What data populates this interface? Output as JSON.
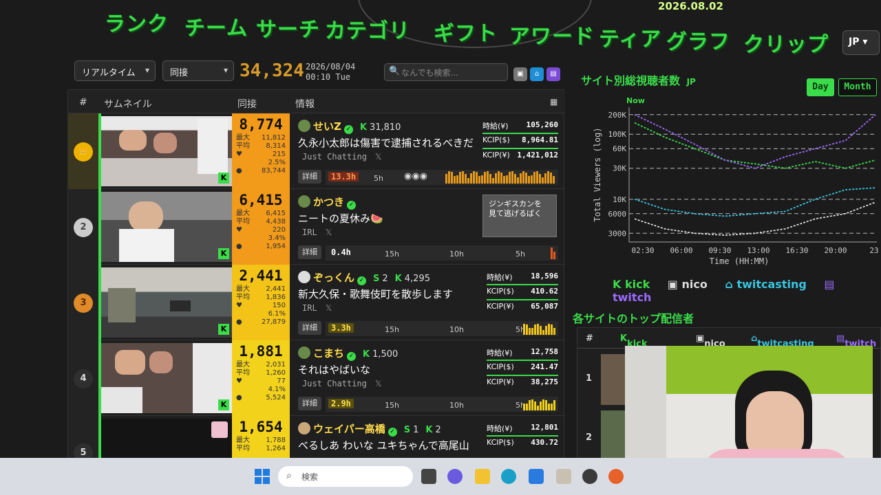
{
  "nav": {
    "items": [
      "ランク",
      "チーム",
      "サーチ",
      "カテゴリ",
      "ギフト",
      "アワード",
      "ティア",
      "グラフ",
      "クリップ"
    ],
    "date": "2026.08.02",
    "lang": "JP ▾"
  },
  "controls": {
    "mode": "リアルタイム",
    "sort": "同接",
    "total_viewers": "34,324",
    "date": "2026/08/04",
    "time": "00:10 Tue",
    "search_placeholder": "なんでも検索...",
    "sites": [
      "nico-icon",
      "twitcasting-icon",
      "twitch-icon"
    ]
  },
  "table": {
    "headers": {
      "rank": "#",
      "thumb": "サムネイル",
      "viewers": "同接",
      "info": "情報"
    },
    "rows": [
      {
        "rank": "1",
        "viewers": "8,774",
        "max_label": "最大",
        "max": "11,812",
        "avg_label": "平均",
        "avg": "8,314",
        "extra1": "215",
        "extra2": "2.5%",
        "extra3": "83,744",
        "name": "せいZ",
        "follow": "31,810",
        "title": "久永小太郎は傷害で逮捕されるべきだ",
        "category": "Just Chatting",
        "detail": "詳細",
        "duration": "13.3h",
        "tick1": "5h",
        "stat1_label": "時給(¥)",
        "stat1": "105,260",
        "stat2_label": "KCIP($)",
        "stat2": "8,964.81",
        "stat3_label": "KCIP(¥)",
        "stat3": "1,421,012"
      },
      {
        "rank": "2",
        "viewers": "6,415",
        "max_label": "最大",
        "max": "6,415",
        "avg_label": "平均",
        "avg": "4,438",
        "extra1": "220",
        "extra2": "3.4%",
        "extra3": "1,954",
        "name": "かつき",
        "title": "ニートの夏休み🍉",
        "category": "IRL",
        "detail": "詳細",
        "duration": "0.4h",
        "tick1": "15h",
        "tick2": "10h",
        "tick3": "5h",
        "clip_text": "ジンギスカンを 見て逃げるばく"
      },
      {
        "rank": "3",
        "viewers": "2,441",
        "max_label": "最大",
        "max": "2,441",
        "avg_label": "平均",
        "avg": "1,836",
        "extra1": "150",
        "extra2": "6.1%",
        "extra3": "27,879",
        "name": "ぞっくん",
        "s_count": "2",
        "follow": "4,295",
        "title": "新大久保・歌舞伎町を散歩します",
        "category": "IRL",
        "detail": "詳細",
        "duration": "3.3h",
        "tick1": "15h",
        "tick2": "10h",
        "tick3": "5h",
        "stat1_label": "時給(¥)",
        "stat1": "18,596",
        "stat2_label": "KCIP($)",
        "stat2": "410.62",
        "stat3_label": "KCIP(¥)",
        "stat3": "65,087"
      },
      {
        "rank": "4",
        "viewers": "1,881",
        "max_label": "最大",
        "max": "2,031",
        "avg_label": "平均",
        "avg": "1,260",
        "extra1": "77",
        "extra2": "4.1%",
        "extra3": "5,524",
        "name": "こまち",
        "follow": "1,500",
        "title": "それはやばいな",
        "category": "Just Chatting",
        "detail": "詳細",
        "duration": "2.9h",
        "tick1": "15h",
        "tick2": "10h",
        "tick3": "5h",
        "stat1_label": "時給(¥)",
        "stat1": "12,758",
        "stat2_label": "KCIP($)",
        "stat2": "241.47",
        "stat3_label": "KCIP(¥)",
        "stat3": "38,275"
      },
      {
        "rank": "5",
        "viewers": "1,654",
        "max_label": "最大",
        "max": "1,788",
        "avg_label": "平均",
        "avg": "1,264",
        "name": "ウェイパー高橋",
        "s_count": "1",
        "follow": "2",
        "title": "べるしあ わいな ユキちゃんで高尾山",
        "stat1_label": "時給(¥)",
        "stat1": "12,801",
        "stat2_label": "KCIP($)",
        "stat2": "430.72"
      }
    ]
  },
  "side": {
    "chart_title": "サイト別総視聴者数",
    "chart_title_suffix": "JP",
    "range_day": "Day",
    "range_month": "Month",
    "top_title": "各サイトのトップ配信者"
  },
  "chart_data": {
    "type": "line",
    "ylabel": "Total Viewers (log)",
    "xlabel": "Time (HH:MM)",
    "yscale": "log",
    "y_ticks": [
      "200K",
      "100K",
      "60K",
      "30K",
      "10K",
      "6000",
      "3000"
    ],
    "x_ticks": [
      "02:30",
      "06:00",
      "09:30",
      "13:00",
      "16:30",
      "20:00",
      "23"
    ],
    "now_label": "Now",
    "series": [
      {
        "name": "kick",
        "color": "#3bdc4a",
        "values": [
          150000,
          90000,
          60000,
          40000,
          35000,
          30000,
          38000,
          30000,
          40000
        ]
      },
      {
        "name": "nico",
        "color": "#dddddd",
        "values": [
          5000,
          3500,
          3000,
          2800,
          3000,
          3500,
          5000,
          6000,
          9000
        ]
      },
      {
        "name": "twitcasting",
        "color": "#39c6e0",
        "values": [
          10000,
          7000,
          6000,
          5500,
          6000,
          6500,
          10000,
          14000,
          15000
        ]
      },
      {
        "name": "twitch",
        "color": "#9b6bff",
        "values": [
          200000,
          120000,
          70000,
          40000,
          30000,
          45000,
          60000,
          80000,
          200000
        ]
      }
    ],
    "legend": [
      "kick",
      "nico",
      "twitcasting",
      "twitch"
    ]
  },
  "top_table": {
    "headers": [
      "#",
      "kick",
      "nico",
      "twitcasting",
      "twitch"
    ],
    "rows": [
      "1",
      "2"
    ]
  },
  "taskbar": {
    "search_placeholder": "検索"
  }
}
